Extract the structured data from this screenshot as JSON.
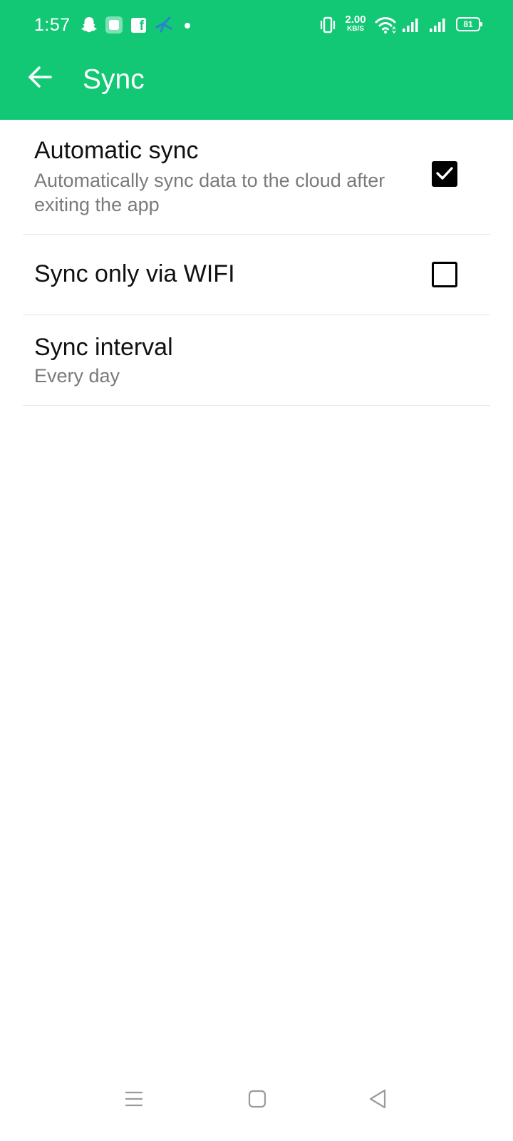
{
  "status_bar": {
    "time": "1:57",
    "net_speed_value": "2.00",
    "net_speed_unit": "KB/S",
    "battery_level": "81",
    "icons": [
      "snapchat-icon",
      "app-icon",
      "facebook-icon",
      "carrier-icon",
      "notification-dot-icon",
      "vibrate-icon",
      "wifi-icon",
      "signal-icon",
      "signal-icon",
      "battery-icon"
    ]
  },
  "app_bar": {
    "title": "Sync",
    "back_icon": "arrow-left-icon",
    "background_color": "#12c875"
  },
  "settings": [
    {
      "title": "Automatic sync",
      "subtitle": "Automatically sync data to the cloud after exiting the app",
      "checked": true
    },
    {
      "title": "Sync only via WIFI",
      "checked": false
    },
    {
      "title": "Sync interval",
      "subtitle": "Every day"
    }
  ],
  "nav_bar": {
    "icons": [
      "menu-icon",
      "home-icon",
      "back-triangle-icon"
    ]
  }
}
